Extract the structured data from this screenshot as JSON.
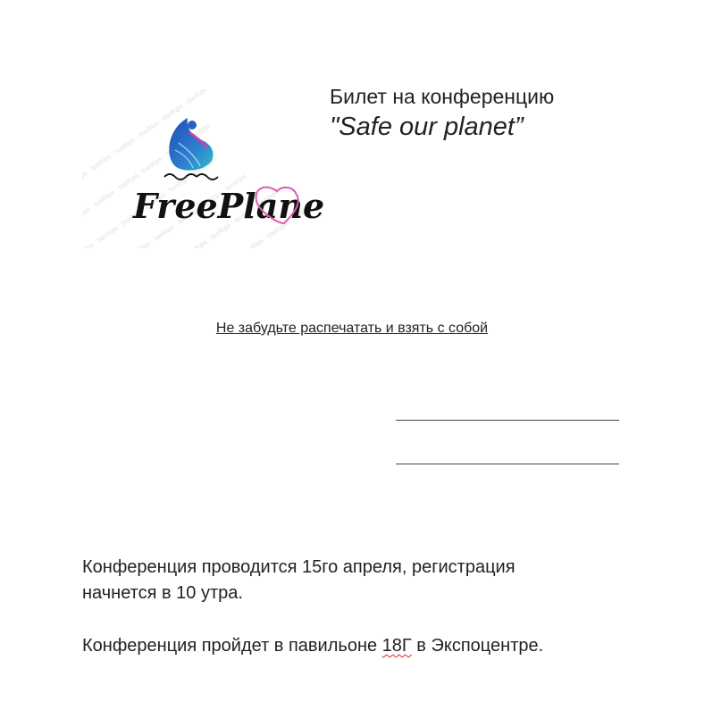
{
  "logo": {
    "brand_text": "FreePlanet",
    "accent_blue": "#1e4db5",
    "accent_magenta": "#d93aa6",
    "heart_color": "#e05bb1"
  },
  "ticket": {
    "title": "Билет на конференцию",
    "subtitle": "\"Safe our planet”",
    "reminder": "Не забудьте распечатать и взять с собой"
  },
  "info": {
    "date_line_1": "Конференция проводится 15го апреля, регистрация",
    "date_line_2": "начнется в 10 утра.",
    "venue_before": "Конференция пройдет в павильоне ",
    "venue_pavilion": "18Г",
    "venue_after": " в Экспоцентре."
  }
}
